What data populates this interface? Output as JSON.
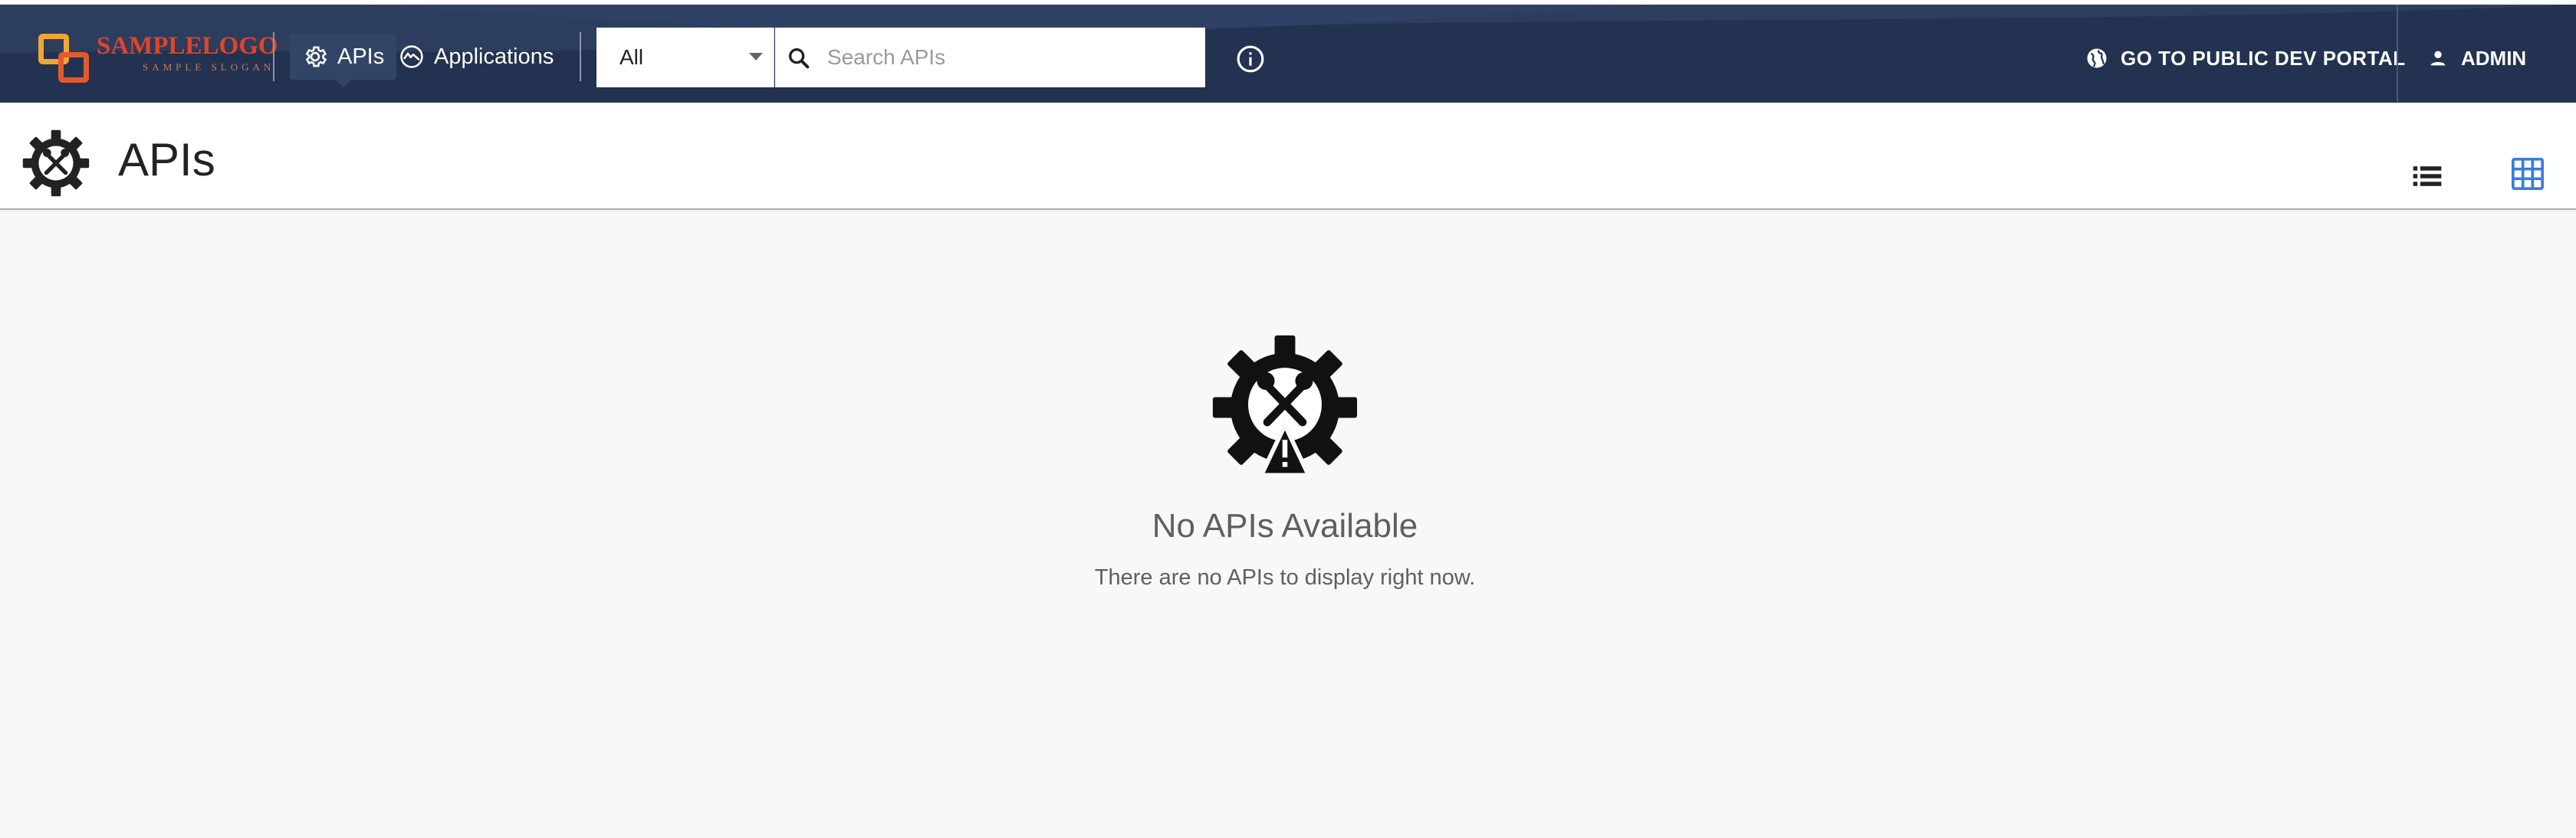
{
  "app": {
    "logo_name": "SAMPLELOGO",
    "logo_slogan": "SAMPLE SLOGAN"
  },
  "nav": {
    "apis_label": "APIs",
    "applications_label": "Applications",
    "active": "APIs"
  },
  "search": {
    "scope_value": "All",
    "placeholder": "Search APIs",
    "value": ""
  },
  "header_actions": {
    "portal_label": "GO TO PUBLIC DEV PORTAL",
    "admin_label": "ADMIN"
  },
  "page": {
    "title": "APIs",
    "active_view": "grid"
  },
  "empty_state": {
    "title": "No APIs Available",
    "description": "There are no APIs to display right now."
  },
  "colors": {
    "topbar": "#233250",
    "logo_orange": "#f3a533",
    "logo_red": "#e25a2c",
    "grid_view_active": "#3b7be0",
    "page_bg": "#f8f8f8"
  },
  "icons": {
    "apis_nav": "gear-icon",
    "applications_nav": "applications-icon",
    "search": "search-icon",
    "info": "info-icon",
    "portal": "globe-icon",
    "admin": "person-icon",
    "page_header": "api-gear-tools-icon",
    "list_view": "list-view-icon",
    "grid_view": "grid-view-icon",
    "empty_state": "api-warning-icon"
  }
}
